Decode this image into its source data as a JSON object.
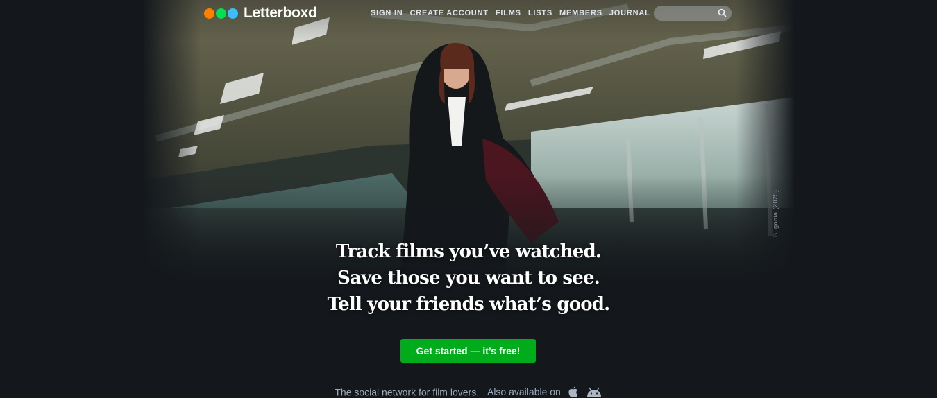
{
  "brand": {
    "name": "Letterboxd",
    "dots": [
      "#ff8000",
      "#00e054",
      "#40bcf4"
    ]
  },
  "nav": {
    "items": [
      {
        "label": "SIGN IN"
      },
      {
        "label": "CREATE ACCOUNT"
      },
      {
        "label": "FILMS"
      },
      {
        "label": "LISTS"
      },
      {
        "label": "MEMBERS"
      },
      {
        "label": "JOURNAL"
      }
    ]
  },
  "search": {
    "placeholder": "",
    "icon": "search-icon"
  },
  "backdrop": {
    "credit": "Bugonia (2025)"
  },
  "hero": {
    "line1": "Track films you’ve watched.",
    "line2": "Save those you want to see.",
    "line3": "Tell your friends what’s good."
  },
  "cta": {
    "label": "Get started — it’s free!",
    "color": "#00ac1c"
  },
  "footer": {
    "tagline": "The social network for film lovers.",
    "available": "Also available on",
    "platforms": [
      "apple-icon",
      "android-icon"
    ]
  }
}
